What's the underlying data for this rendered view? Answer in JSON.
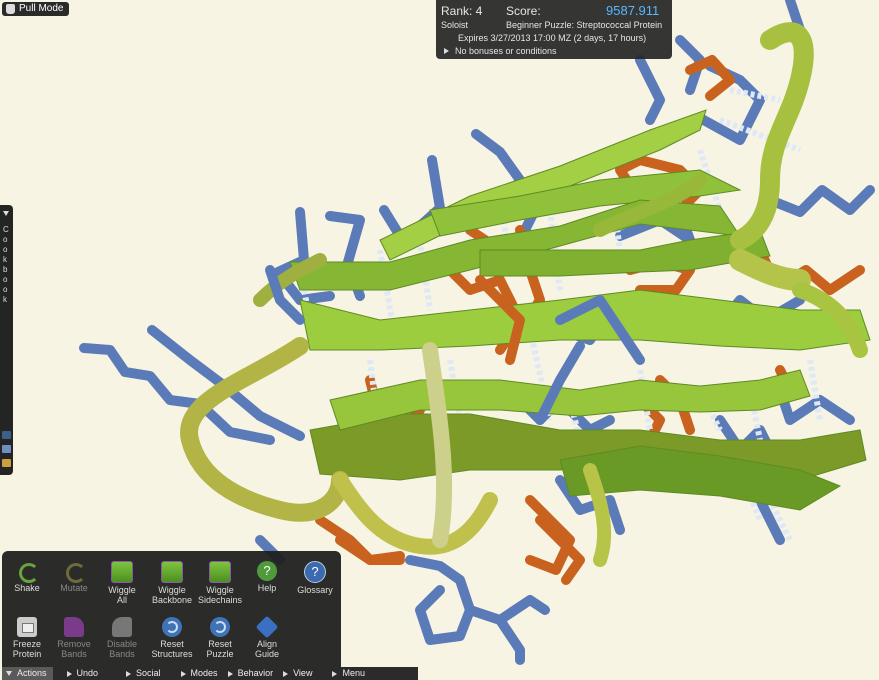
{
  "mode": {
    "label": "Pull Mode"
  },
  "score_panel": {
    "rank_label": "Rank: 4",
    "score_label": "Score:",
    "score_value": "9587.911",
    "player_type": "Soloist",
    "puzzle_name": "Beginner Puzzle: Streptococcal Protein",
    "expires": "Expires 3/27/2013 17:00 MZ (2 days, 17 hours)",
    "bonuses": "No bonuses or conditions"
  },
  "cookbook": {
    "label": "Cookbook"
  },
  "tools": {
    "shake": "Shake",
    "mutate": "Mutate",
    "wiggle_all_1": "Wiggle",
    "wiggle_all_2": "All",
    "wiggle_backbone_1": "Wiggle",
    "wiggle_backbone_2": "Backbone",
    "wiggle_sidechains_1": "Wiggle",
    "wiggle_sidechains_2": "Sidechains",
    "help": "Help",
    "glossary": "Glossary",
    "freeze_1": "Freeze",
    "freeze_2": "Protein",
    "remove_bands_1": "Remove",
    "remove_bands_2": "Bands",
    "disable_bands_1": "Disable",
    "disable_bands_2": "Bands",
    "reset_structures_1": "Reset",
    "reset_structures_2": "Structures",
    "reset_puzzle_1": "Reset",
    "reset_puzzle_2": "Puzzle",
    "align_guide_1": "Align",
    "align_guide_2": "Guide"
  },
  "menu": {
    "actions": "Actions",
    "undo": "Undo",
    "social": "Social",
    "modes": "Modes",
    "behavior": "Behavior",
    "view": "View",
    "menu": "Menu"
  },
  "colors": {
    "background": "#f7f4e4",
    "sheet": "#8fc23a",
    "sheet_dark": "#6a9a26",
    "loop": "#a6b240",
    "sidechain_blue": "#5b7bb8",
    "sidechain_orange": "#c8621e",
    "hbond": "#dfe8f5",
    "score_value": "#59b7ff"
  }
}
